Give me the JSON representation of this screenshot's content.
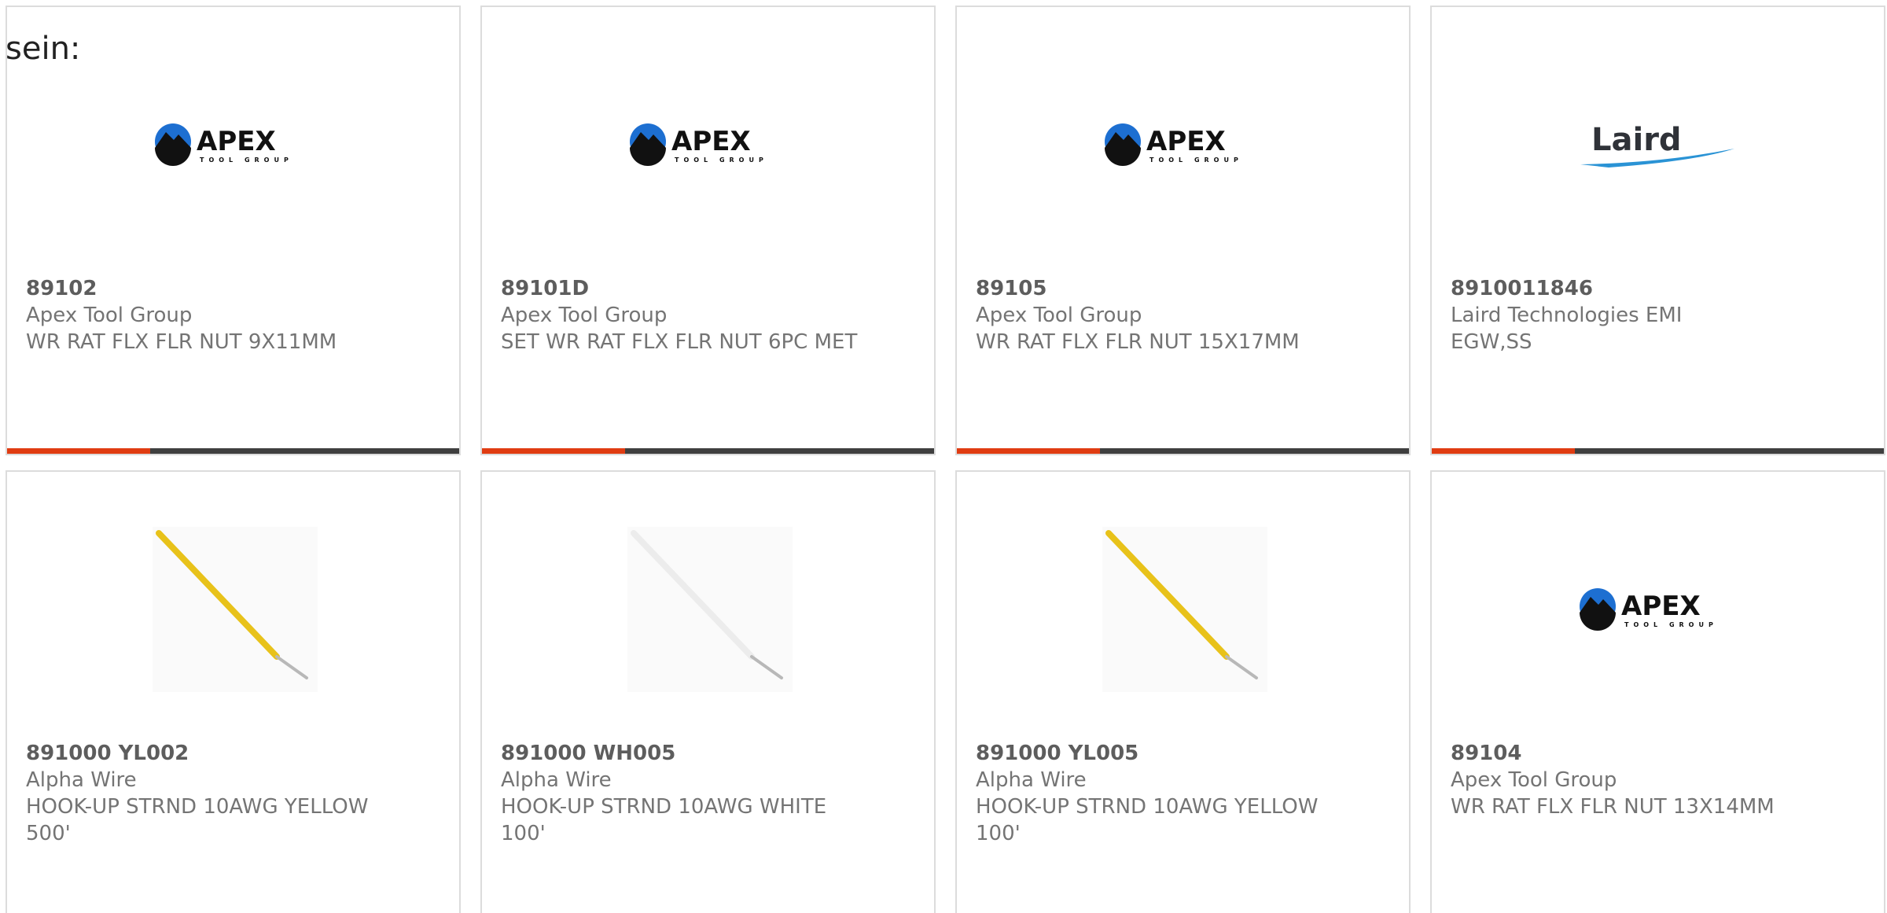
{
  "overlay_label": "sein:",
  "accent_color": "#e03c12",
  "bar_color": "#3f3f3f",
  "products": [
    {
      "part": "89102",
      "manufacturer": "Apex Tool Group",
      "description": "WR RAT FLX FLR NUT 9X11MM",
      "image": "apex-tool-group-logo"
    },
    {
      "part": "89101D",
      "manufacturer": "Apex Tool Group",
      "description": "SET WR RAT FLX FLR NUT 6PC MET",
      "image": "apex-tool-group-logo"
    },
    {
      "part": "89105",
      "manufacturer": "Apex Tool Group",
      "description": "WR RAT FLX FLR NUT 15X17MM",
      "image": "apex-tool-group-logo"
    },
    {
      "part": "8910011846",
      "manufacturer": "Laird Technologies EMI",
      "description": "EGW,SS",
      "image": "laird-logo"
    },
    {
      "part": "891000 YL002",
      "manufacturer": "Alpha Wire",
      "description": "HOOK-UP STRND 10AWG YELLOW 500'",
      "image": "yellow-wire"
    },
    {
      "part": "891000 WH005",
      "manufacturer": "Alpha Wire",
      "description": "HOOK-UP STRND 10AWG WHITE 100'",
      "image": "white-wire"
    },
    {
      "part": "891000 YL005",
      "manufacturer": "Alpha Wire",
      "description": "HOOK-UP STRND 10AWG YELLOW 100'",
      "image": "yellow-wire"
    },
    {
      "part": "89104",
      "manufacturer": "Apex Tool Group",
      "description": "WR RAT FLX FLR NUT 13X14MM",
      "image": "apex-tool-group-logo"
    }
  ],
  "logo_text": {
    "apex_main": "APEX",
    "apex_sub": "TOOL GROUP",
    "laird_main": "Laird"
  }
}
